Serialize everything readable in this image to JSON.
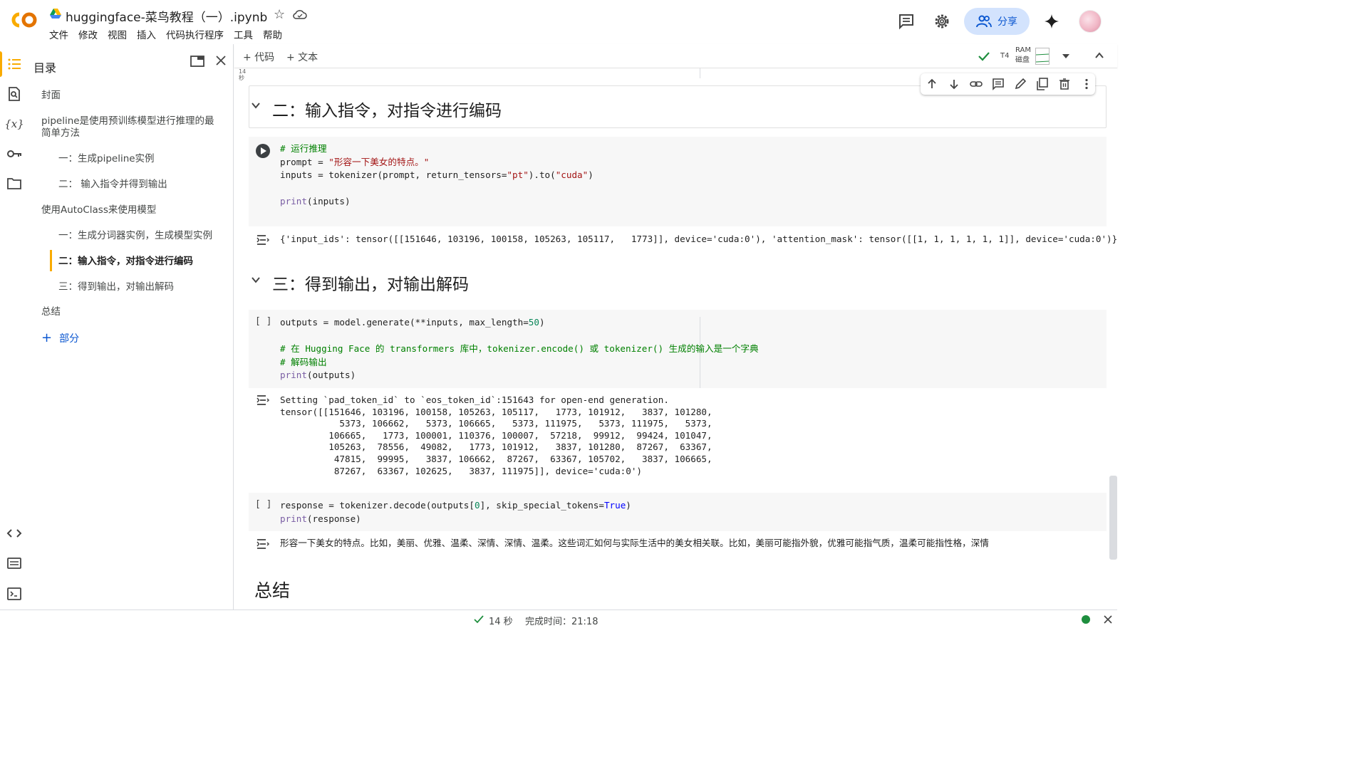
{
  "header": {
    "title": "huggingface-菜鸟教程（一）.ipynb",
    "menu": [
      "文件",
      "修改",
      "视图",
      "插入",
      "代码执行程序",
      "工具",
      "帮助"
    ],
    "share_label": "分享"
  },
  "toc": {
    "title": "目录",
    "items": [
      {
        "label": "封面"
      },
      {
        "label": "pipeline是使用预训练模型进行推理的最简单方法"
      },
      {
        "label": "一：生成pipeline实例"
      },
      {
        "label": "二： 输入指令并得到输出"
      },
      {
        "label": "使用AutoClass来使用模型"
      },
      {
        "label": "一：生成分词器实例，生成模型实例"
      },
      {
        "label": "二：输入指令，对指令进行编码"
      },
      {
        "label": "三：得到输出，对输出解码"
      },
      {
        "label": "总结"
      }
    ],
    "add_section": "部分"
  },
  "toolbar": {
    "add_code": "+ 代码",
    "add_text": "+ 文本",
    "runtime": "T4",
    "ram_label": "RAM",
    "disk_label": "磁盘"
  },
  "notebook": {
    "prev_exec_time": "14",
    "prev_exec_unit": "秒",
    "heading_2": "二：输入指令，对指令进行编码",
    "heading_3": "三：得到输出，对输出解码",
    "heading_summary": "总结",
    "empty_bracket": "[ ]",
    "cell1_output": "{'input_ids': tensor([[151646, 103196, 100158, 105263, 105117,   1773]], device='cuda:0'), 'attention_mask': tensor([[1, 1, 1, 1, 1, 1]], device='cuda:0')}",
    "cell2_output_lines": [
      "Setting `pad_token_id` to `eos_token_id`:151643 for open-end generation.",
      "tensor([[151646, 103196, 100158, 105263, 105117,   1773, 101912,   3837, 101280,",
      "           5373, 106662,   5373, 106665,   5373, 111975,   5373, 111975,   5373,",
      "         106665,   1773, 100001, 110376, 100007,  57218,  99912,  99424, 101047,",
      "         105263,  78556,  49082,   1773, 101912,   3837, 101280,  87267,  63367,",
      "          47815,  99995,   3837, 106662,  87267,  63367, 105702,   3837, 106665,",
      "          87267,  63367, 102625,   3837, 111975]], device='cuda:0')"
    ],
    "cell3_output": "形容一下美女的特点。比如，美丽、优雅、温柔、深情、深情、温柔。这些词汇如何与实际生活中的美女相关联。比如，美丽可能指外貌，优雅可能指气质，温柔可能指性格，深情"
  },
  "status": {
    "elapsed": "14 秒",
    "completed": "完成时间：21:18"
  },
  "colors": {
    "accent": "#0b57d0",
    "toc_highlight": "#f9ab00",
    "share_bg": "#d3e3fd",
    "status_dot": "#1e8e3e"
  }
}
